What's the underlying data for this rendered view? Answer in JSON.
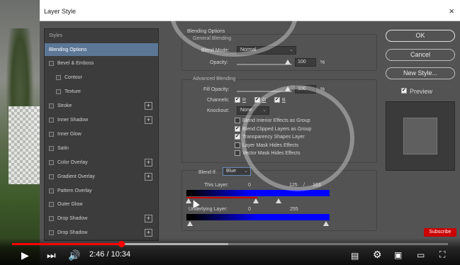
{
  "window": {
    "title": "Layer Style",
    "close": "×"
  },
  "styles_panel": {
    "header": "Styles",
    "items": [
      {
        "label": "Blending Options",
        "active": true,
        "checkbox": false,
        "plus": false
      },
      {
        "label": "Bevel & Emboss",
        "checkbox": true,
        "plus": false
      },
      {
        "label": "Contour",
        "checkbox": true,
        "indent": true,
        "plus": false
      },
      {
        "label": "Texture",
        "checkbox": true,
        "indent": true,
        "plus": false
      },
      {
        "label": "Stroke",
        "checkbox": true,
        "plus": true
      },
      {
        "label": "Inner Shadow",
        "checkbox": true,
        "plus": true
      },
      {
        "label": "Inner Glow",
        "checkbox": true,
        "plus": false
      },
      {
        "label": "Satin",
        "checkbox": true,
        "plus": false
      },
      {
        "label": "Color Overlay",
        "checkbox": true,
        "plus": true
      },
      {
        "label": "Gradient Overlay",
        "checkbox": true,
        "plus": true
      },
      {
        "label": "Pattern Overlay",
        "checkbox": true,
        "plus": false
      },
      {
        "label": "Outer Glow",
        "checkbox": true,
        "plus": false
      },
      {
        "label": "Drop Shadow",
        "checkbox": true,
        "plus": true
      },
      {
        "label": "Drop Shadow",
        "checkbox": true,
        "plus": true
      }
    ]
  },
  "blending": {
    "section_title": "Blending Options",
    "general_title": "General Blending",
    "blend_mode_label": "Blend Mode:",
    "blend_mode_value": "Normal",
    "opacity_label": "Opacity:",
    "opacity_value": "100",
    "percent": "%",
    "advanced_title": "Advanced Blending",
    "fill_opacity_label": "Fill Opacity:",
    "fill_opacity_value": "100",
    "channels_label": "Channels:",
    "channel_r": "R",
    "channel_g": "G",
    "channel_b": "B",
    "knockout_label": "Knockout:",
    "knockout_value": "None",
    "options": [
      {
        "label": "Blend Interior Effects as Group",
        "checked": false
      },
      {
        "label": "Blend Clipped Layers as Group",
        "checked": true
      },
      {
        "label": "Transparency Shapes Layer",
        "checked": true
      },
      {
        "label": "Layer Mask Hides Effects",
        "checked": false
      },
      {
        "label": "Vector Mask Hides Effects",
        "checked": false
      }
    ],
    "blend_if_label": "Blend If:",
    "blend_if_value": "Blue",
    "this_layer_label": "This Layer:",
    "this_layer_values": [
      "0",
      "125",
      "/",
      "163"
    ],
    "underlying_label": "Underlying Layer:",
    "underlying_values": [
      "0",
      "255"
    ]
  },
  "buttons": {
    "ok": "OK",
    "cancel": "Cancel",
    "new_style": "New Style...",
    "preview": "Preview"
  },
  "video": {
    "time": "2:46 / 10:34",
    "subscribe": "Subscribe",
    "progress": 0.26
  }
}
